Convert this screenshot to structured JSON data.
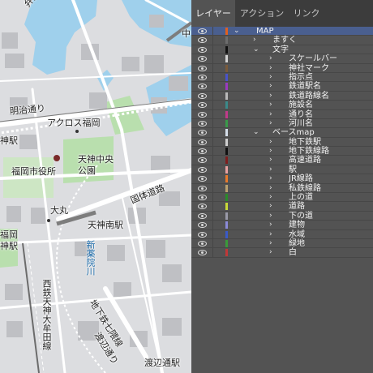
{
  "map": {
    "labels": {
      "bentenbashi": "弁天橋",
      "naka": "中",
      "meiji_dori": "明治通り",
      "across": "アクロス福岡",
      "jin_eki": "神駅",
      "tenjin_chuo_park": "天神中央\n公園",
      "city_hall": "福岡市役所",
      "kokutai_doro": "国体道路",
      "daimaru": "大丸",
      "tenjin_minami": "天神南駅",
      "shin_yakuin": "新薬院川",
      "fukuoka_left": "福岡",
      "jin_eki_left": "神駅",
      "nishitetsu": "西鉄天神大牟田線",
      "subway_nanakuma": "地下鉄七隈線",
      "watanabe_dori": "渡辺通り",
      "watanabe_station": "渡辺通駅"
    }
  },
  "panel": {
    "tabs": [
      "レイヤー",
      "アクション",
      "リンク"
    ],
    "active_tab": 0,
    "layers": [
      {
        "name": "MAP",
        "depth": 0,
        "expanded": true,
        "color": "#e0601e",
        "selected": true
      },
      {
        "name": "ますく",
        "depth": 1,
        "expanded": false,
        "color": "#6d6d6d",
        "selected": false
      },
      {
        "name": "文字",
        "depth": 1,
        "expanded": true,
        "color": "#111111",
        "selected": false
      },
      {
        "name": "スケールバー",
        "depth": 2,
        "expanded": false,
        "color": "#d2d2d2",
        "selected": false
      },
      {
        "name": "神社マーク",
        "depth": 2,
        "expanded": false,
        "color": "#7a5a3a",
        "selected": false
      },
      {
        "name": "指示点",
        "depth": 2,
        "expanded": false,
        "color": "#4a53c8",
        "selected": false
      },
      {
        "name": "鉄道駅名",
        "depth": 2,
        "expanded": false,
        "color": "#9a3ac0",
        "selected": false
      },
      {
        "name": "鉄道路線名",
        "depth": 2,
        "expanded": false,
        "color": "#b9b9b9",
        "selected": false
      },
      {
        "name": "施設名",
        "depth": 2,
        "expanded": false,
        "color": "#3a8a8a",
        "selected": false
      },
      {
        "name": "通り名",
        "depth": 2,
        "expanded": false,
        "color": "#c03a8a",
        "selected": false
      },
      {
        "name": "河川名",
        "depth": 2,
        "expanded": false,
        "color": "#3a9a4a",
        "selected": false
      },
      {
        "name": "ベースmap",
        "depth": 1,
        "expanded": true,
        "color": "#d4dde8",
        "selected": false
      },
      {
        "name": "地下鉄駅",
        "depth": 2,
        "expanded": false,
        "color": "#cfcfcf",
        "selected": false
      },
      {
        "name": "地下鉄線路",
        "depth": 2,
        "expanded": false,
        "color": "#111111",
        "selected": false
      },
      {
        "name": "高速道路",
        "depth": 2,
        "expanded": false,
        "color": "#7e1e1e",
        "selected": false
      },
      {
        "name": "駅",
        "depth": 2,
        "expanded": false,
        "color": "#e8a0a0",
        "selected": false
      },
      {
        "name": "JR線路",
        "depth": 2,
        "expanded": false,
        "color": "#e87a2a",
        "selected": false
      },
      {
        "name": "私鉄線路",
        "depth": 2,
        "expanded": false,
        "color": "#b8a070",
        "selected": false
      },
      {
        "name": "上の道",
        "depth": 2,
        "expanded": false,
        "color": "#2a8a2a",
        "selected": false
      },
      {
        "name": "道路",
        "depth": 2,
        "expanded": false,
        "color": "#c8d838",
        "selected": false
      },
      {
        "name": "下の道",
        "depth": 2,
        "expanded": false,
        "color": "#9a9aa8",
        "selected": false
      },
      {
        "name": "建物",
        "depth": 2,
        "expanded": false,
        "color": "#8a8ad8",
        "selected": false
      },
      {
        "name": "水域",
        "depth": 2,
        "expanded": false,
        "color": "#3a5ac8",
        "selected": false
      },
      {
        "name": "緑地",
        "depth": 2,
        "expanded": false,
        "color": "#3a9a3a",
        "selected": false
      },
      {
        "name": "白",
        "depth": 2,
        "expanded": false,
        "color": "#c03838",
        "selected": false
      }
    ]
  }
}
